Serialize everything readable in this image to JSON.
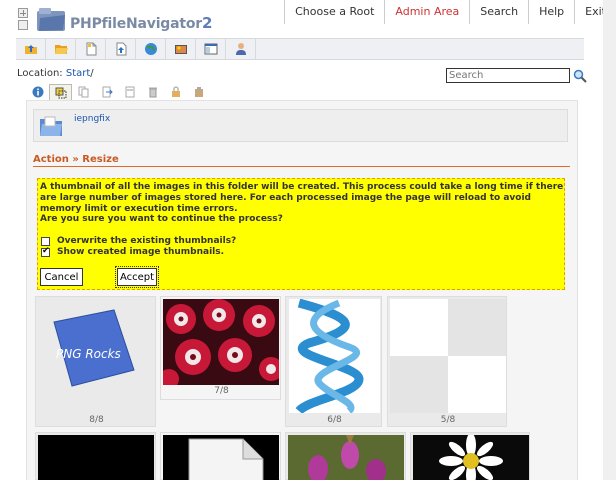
{
  "app": {
    "logo_text": "PHPfileNavigator",
    "logo_suffix": "2"
  },
  "nav": {
    "items": [
      {
        "label": "Choose a Root"
      },
      {
        "label": "Admin Area"
      },
      {
        "label": "Search"
      },
      {
        "label": "Help"
      },
      {
        "label": "Exit"
      }
    ]
  },
  "toolbar": {
    "buttons": [
      "up-folder",
      "open-folder",
      "new-file",
      "upload",
      "web",
      "photos",
      "view-toggle",
      "user"
    ]
  },
  "location": {
    "label": "Location:",
    "start": "Start",
    "separator": "/"
  },
  "search": {
    "placeholder": "Search"
  },
  "folder": {
    "name": "iepngfix"
  },
  "action": {
    "title": "Action » Resize"
  },
  "warning": {
    "text1": "A thumbnail of all the images in this folder will be created. This process could take a long time if there are large number of images stored here. For each processed image the page will reload to avoid memory limit or execution time errors.",
    "text2": "Are you sure you want to continue the process?",
    "option_overwrite": "Overwrite the existing thumbnails?",
    "option_show": "Show created image thumbnails.",
    "overwrite_checked": false,
    "show_checked": true
  },
  "buttons": {
    "cancel": "Cancel",
    "accept": "Accept"
  },
  "thumbnails": [
    {
      "caption": "8/8",
      "subject": "png-rocks"
    },
    {
      "caption": "7/8",
      "subject": "red-flowers"
    },
    {
      "caption": "6/8",
      "subject": "dna-helix"
    },
    {
      "caption": "5/8",
      "subject": "checker"
    }
  ],
  "thumb_texts": {
    "png_rocks": "PNG Rocks"
  },
  "colors": {
    "accent": "#c95a23",
    "link": "#1a55b0",
    "warning_bg": "#ffff00",
    "active_nav": "#cc3333"
  }
}
